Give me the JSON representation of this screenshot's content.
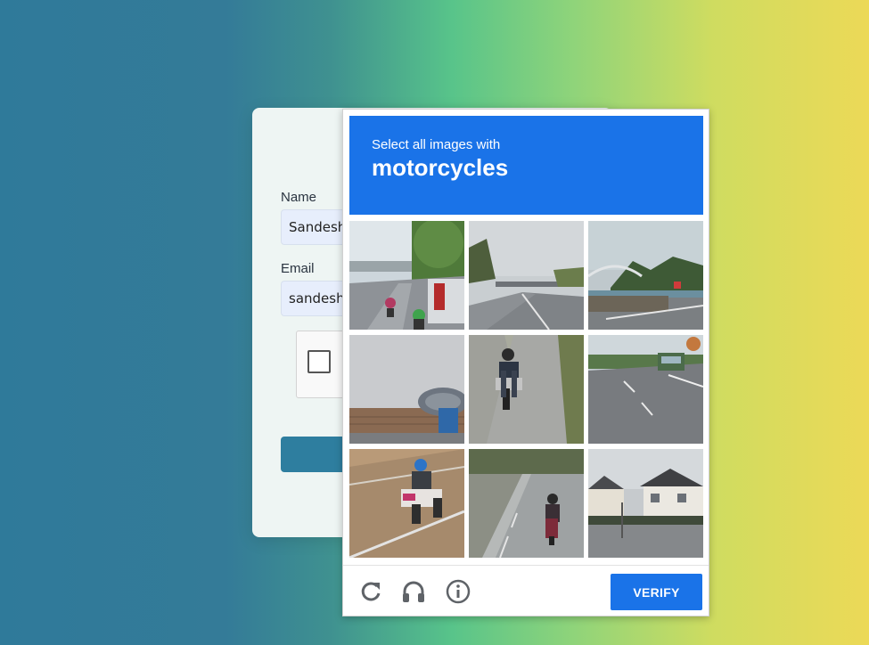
{
  "form": {
    "name_label": "Name",
    "name_value": "Sandesh",
    "email_label": "Email",
    "email_value": "sandesh"
  },
  "challenge": {
    "instruction": "Select all images with",
    "target": "motorcycles",
    "tiles": [
      {
        "scene": "highway with motorcycles and truck",
        "selected": false
      },
      {
        "scene": "empty road near overpass",
        "selected": false
      },
      {
        "scene": "coastal road with bridge",
        "selected": false
      },
      {
        "scene": "brick wall and satellite dish",
        "selected": false
      },
      {
        "scene": "rider on motorcycle",
        "selected": false
      },
      {
        "scene": "road with bus",
        "selected": false
      },
      {
        "scene": "rider on scooter",
        "selected": false
      },
      {
        "scene": "motorcycle on narrow road",
        "selected": false
      },
      {
        "scene": "street with houses",
        "selected": false
      }
    ],
    "footer_icons": [
      "reload-icon",
      "headphones-icon",
      "info-icon"
    ],
    "verify_label": "VERIFY"
  },
  "colors": {
    "accent": "#1a73e8",
    "submit": "#2e7e9f",
    "card": "#eef5f3"
  }
}
